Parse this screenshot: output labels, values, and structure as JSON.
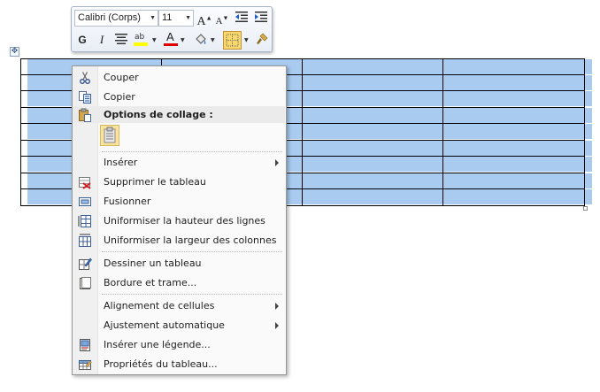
{
  "mini_toolbar": {
    "font_name": "Calibri (Corps)",
    "font_size": "11",
    "buttons_row1": [
      "grow-font-icon",
      "shrink-font-icon",
      "decrease-indent-icon",
      "increase-indent-icon"
    ],
    "buttons_row2": [
      "bold-icon",
      "italic-icon",
      "center-align-icon",
      "highlight-icon",
      "font-color-icon",
      "shading-icon",
      "borders-icon",
      "format-painter-icon"
    ],
    "bold_label": "G",
    "italic_label": "I",
    "font_color_label": "A",
    "grow_label": "A",
    "shrink_label": "A",
    "highlight_label": "ab",
    "highlight_color": "#ffff00",
    "font_color": "#e00000"
  },
  "table": {
    "rows": 9,
    "columns": 4,
    "selection_color": "#a9cbf0"
  },
  "context_menu": {
    "items": [
      {
        "label": "Couper",
        "icon": "scissors-icon"
      },
      {
        "label": "Copier",
        "icon": "copy-icon"
      },
      {
        "label": "Options de collage :",
        "icon": "paste-icon"
      },
      {
        "label": "Insérer",
        "icon": "",
        "submenu": true
      },
      {
        "label": "Supprimer le tableau",
        "icon": "delete-table-icon"
      },
      {
        "label": "Fusionner",
        "icon": "merge-cells-icon"
      },
      {
        "label": "Uniformiser la hauteur des lignes",
        "icon": "distribute-rows-icon"
      },
      {
        "label": "Uniformiser la largeur des colonnes",
        "icon": "distribute-columns-icon"
      },
      {
        "label": "Dessiner un tableau",
        "icon": "draw-table-icon"
      },
      {
        "label": "Bordure et trame...",
        "icon": "borders-shading-icon"
      },
      {
        "label": "Alignement de cellules",
        "icon": "",
        "submenu": true
      },
      {
        "label": "Ajustement automatique",
        "icon": "",
        "submenu": true
      },
      {
        "label": "Insérer une légende...",
        "icon": "insert-caption-icon"
      },
      {
        "label": "Propriétés du tableau...",
        "icon": "table-properties-icon"
      }
    ]
  }
}
